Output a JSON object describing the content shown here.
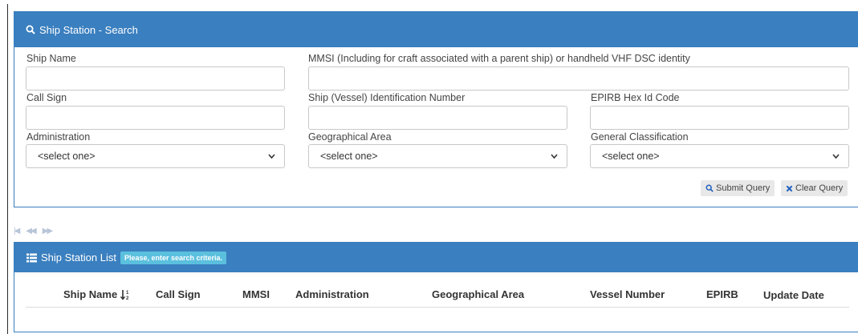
{
  "search_panel": {
    "title": "Ship Station - Search",
    "fields": {
      "ship_name": {
        "label": "Ship Name",
        "value": ""
      },
      "mmsi": {
        "label": "MMSI (Including for craft associated with a parent ship) or handheld VHF DSC identity",
        "value": ""
      },
      "call_sign": {
        "label": "Call Sign",
        "value": ""
      },
      "vessel_id": {
        "label": "Ship (Vessel) Identification Number",
        "value": ""
      },
      "epirb": {
        "label": "EPIRB Hex Id Code",
        "value": ""
      },
      "administration": {
        "label": "Administration",
        "selected": "<select one>"
      },
      "geo_area": {
        "label": "Geographical Area",
        "selected": "<select one>"
      },
      "classification": {
        "label": "General Classification",
        "selected": "<select one>"
      }
    },
    "buttons": {
      "submit": "Submit Query",
      "clear": "Clear Query"
    }
  },
  "list_panel": {
    "title": "Ship Station List",
    "badge": "Please, enter search criteria.",
    "columns": [
      "Ship Name",
      "Call Sign",
      "MMSI",
      "Administration",
      "Geographical Area",
      "Vessel Number",
      "EPIRB",
      "Update Date"
    ]
  },
  "colors": {
    "panel_header": "#3a7fbf",
    "badge": "#5bc0de",
    "clear_icon": "#1f5fbf"
  }
}
